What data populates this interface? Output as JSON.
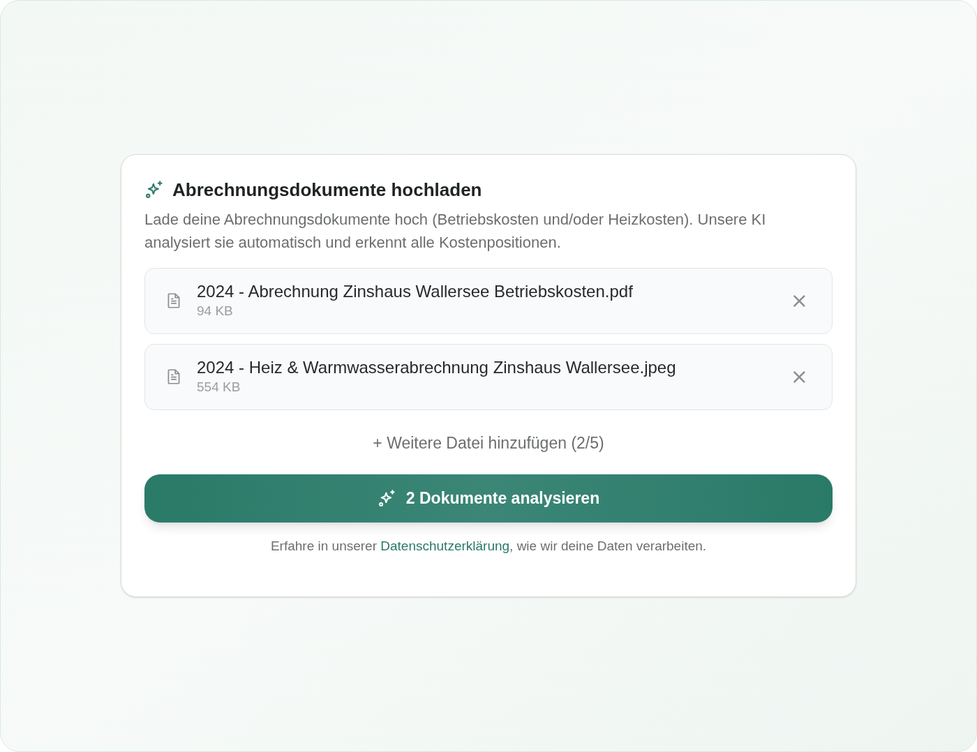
{
  "card": {
    "title": "Abrechnungsdokumente hochladen",
    "description": "Lade deine Abrechnungsdokumente hoch (Betriebskosten und/oder Heizkosten). Unsere KI analysiert sie automatisch und erkennt alle Kostenpositionen.",
    "files": [
      {
        "name": "2024 - Abrechnung Zinshaus Wallersee Betriebskosten.pdf",
        "size": "94 KB",
        "remove": "×"
      },
      {
        "name": "2024 - Heiz & Warmwasserabrechnung Zinshaus Wallersee.jpeg",
        "size": "554 KB",
        "remove": "×"
      }
    ],
    "add_link": "+ Weitere Datei hinzufügen (2/5)",
    "analyze_button": "2 Dokumente analysieren",
    "privacy_note": {
      "before": "Erfahre in unserer ",
      "link": "Datenschutzerklärung",
      "after": ", wie wir deine Daten verarbeiten."
    }
  }
}
